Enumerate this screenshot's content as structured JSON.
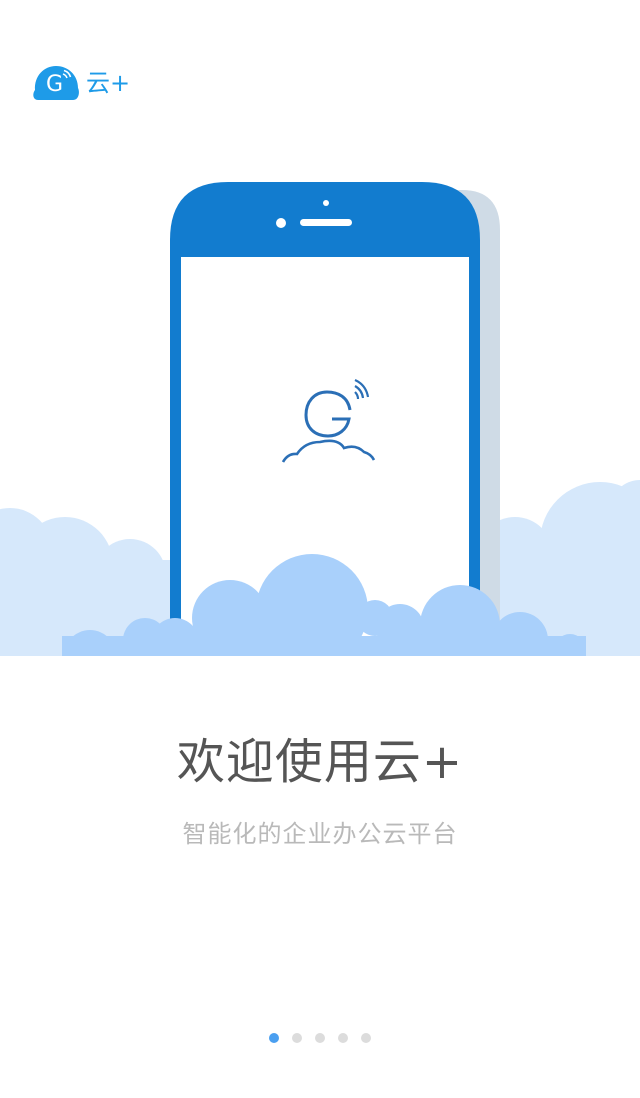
{
  "brand": {
    "name": "云+",
    "icon": "cloud-g-logo-icon"
  },
  "hero": {
    "device": "phone-illustration",
    "screen_icon": "g-cloud-wifi-icon"
  },
  "welcome": {
    "title": "欢迎使用云+",
    "subtitle": "智能化的企业办公云平台"
  },
  "pager": {
    "active_index": 0,
    "count": 5
  },
  "colors": {
    "brand_blue": "#1e9be8",
    "phone_blue": "#127ccf",
    "cloud_light": "#d6e8fb",
    "cloud_mid": "#a9d0fb",
    "title_gray": "#555555",
    "subtitle_gray": "#b9b9b9",
    "dot_active": "#4a9ff0",
    "dot_inactive": "#dcdcdc"
  }
}
